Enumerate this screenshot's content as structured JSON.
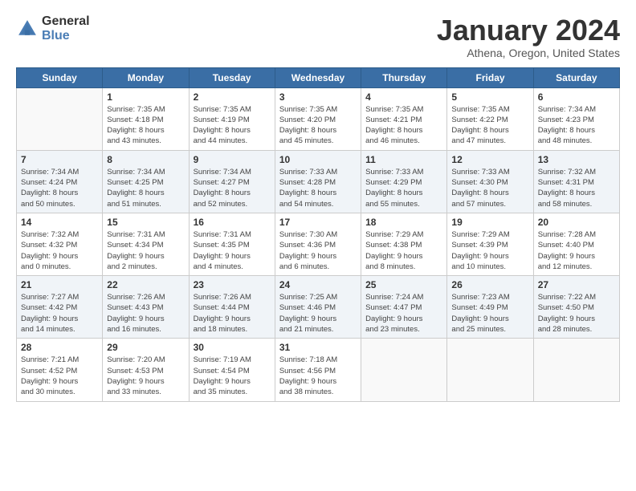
{
  "header": {
    "logo_general": "General",
    "logo_blue": "Blue",
    "month_title": "January 2024",
    "location": "Athena, Oregon, United States"
  },
  "days_of_week": [
    "Sunday",
    "Monday",
    "Tuesday",
    "Wednesday",
    "Thursday",
    "Friday",
    "Saturday"
  ],
  "weeks": [
    [
      {
        "day": "",
        "info": ""
      },
      {
        "day": "1",
        "info": "Sunrise: 7:35 AM\nSunset: 4:18 PM\nDaylight: 8 hours\nand 43 minutes."
      },
      {
        "day": "2",
        "info": "Sunrise: 7:35 AM\nSunset: 4:19 PM\nDaylight: 8 hours\nand 44 minutes."
      },
      {
        "day": "3",
        "info": "Sunrise: 7:35 AM\nSunset: 4:20 PM\nDaylight: 8 hours\nand 45 minutes."
      },
      {
        "day": "4",
        "info": "Sunrise: 7:35 AM\nSunset: 4:21 PM\nDaylight: 8 hours\nand 46 minutes."
      },
      {
        "day": "5",
        "info": "Sunrise: 7:35 AM\nSunset: 4:22 PM\nDaylight: 8 hours\nand 47 minutes."
      },
      {
        "day": "6",
        "info": "Sunrise: 7:34 AM\nSunset: 4:23 PM\nDaylight: 8 hours\nand 48 minutes."
      }
    ],
    [
      {
        "day": "7",
        "info": "Sunrise: 7:34 AM\nSunset: 4:24 PM\nDaylight: 8 hours\nand 50 minutes."
      },
      {
        "day": "8",
        "info": "Sunrise: 7:34 AM\nSunset: 4:25 PM\nDaylight: 8 hours\nand 51 minutes."
      },
      {
        "day": "9",
        "info": "Sunrise: 7:34 AM\nSunset: 4:27 PM\nDaylight: 8 hours\nand 52 minutes."
      },
      {
        "day": "10",
        "info": "Sunrise: 7:33 AM\nSunset: 4:28 PM\nDaylight: 8 hours\nand 54 minutes."
      },
      {
        "day": "11",
        "info": "Sunrise: 7:33 AM\nSunset: 4:29 PM\nDaylight: 8 hours\nand 55 minutes."
      },
      {
        "day": "12",
        "info": "Sunrise: 7:33 AM\nSunset: 4:30 PM\nDaylight: 8 hours\nand 57 minutes."
      },
      {
        "day": "13",
        "info": "Sunrise: 7:32 AM\nSunset: 4:31 PM\nDaylight: 8 hours\nand 58 minutes."
      }
    ],
    [
      {
        "day": "14",
        "info": "Sunrise: 7:32 AM\nSunset: 4:32 PM\nDaylight: 9 hours\nand 0 minutes."
      },
      {
        "day": "15",
        "info": "Sunrise: 7:31 AM\nSunset: 4:34 PM\nDaylight: 9 hours\nand 2 minutes."
      },
      {
        "day": "16",
        "info": "Sunrise: 7:31 AM\nSunset: 4:35 PM\nDaylight: 9 hours\nand 4 minutes."
      },
      {
        "day": "17",
        "info": "Sunrise: 7:30 AM\nSunset: 4:36 PM\nDaylight: 9 hours\nand 6 minutes."
      },
      {
        "day": "18",
        "info": "Sunrise: 7:29 AM\nSunset: 4:38 PM\nDaylight: 9 hours\nand 8 minutes."
      },
      {
        "day": "19",
        "info": "Sunrise: 7:29 AM\nSunset: 4:39 PM\nDaylight: 9 hours\nand 10 minutes."
      },
      {
        "day": "20",
        "info": "Sunrise: 7:28 AM\nSunset: 4:40 PM\nDaylight: 9 hours\nand 12 minutes."
      }
    ],
    [
      {
        "day": "21",
        "info": "Sunrise: 7:27 AM\nSunset: 4:42 PM\nDaylight: 9 hours\nand 14 minutes."
      },
      {
        "day": "22",
        "info": "Sunrise: 7:26 AM\nSunset: 4:43 PM\nDaylight: 9 hours\nand 16 minutes."
      },
      {
        "day": "23",
        "info": "Sunrise: 7:26 AM\nSunset: 4:44 PM\nDaylight: 9 hours\nand 18 minutes."
      },
      {
        "day": "24",
        "info": "Sunrise: 7:25 AM\nSunset: 4:46 PM\nDaylight: 9 hours\nand 21 minutes."
      },
      {
        "day": "25",
        "info": "Sunrise: 7:24 AM\nSunset: 4:47 PM\nDaylight: 9 hours\nand 23 minutes."
      },
      {
        "day": "26",
        "info": "Sunrise: 7:23 AM\nSunset: 4:49 PM\nDaylight: 9 hours\nand 25 minutes."
      },
      {
        "day": "27",
        "info": "Sunrise: 7:22 AM\nSunset: 4:50 PM\nDaylight: 9 hours\nand 28 minutes."
      }
    ],
    [
      {
        "day": "28",
        "info": "Sunrise: 7:21 AM\nSunset: 4:52 PM\nDaylight: 9 hours\nand 30 minutes."
      },
      {
        "day": "29",
        "info": "Sunrise: 7:20 AM\nSunset: 4:53 PM\nDaylight: 9 hours\nand 33 minutes."
      },
      {
        "day": "30",
        "info": "Sunrise: 7:19 AM\nSunset: 4:54 PM\nDaylight: 9 hours\nand 35 minutes."
      },
      {
        "day": "31",
        "info": "Sunrise: 7:18 AM\nSunset: 4:56 PM\nDaylight: 9 hours\nand 38 minutes."
      },
      {
        "day": "",
        "info": ""
      },
      {
        "day": "",
        "info": ""
      },
      {
        "day": "",
        "info": ""
      }
    ]
  ]
}
